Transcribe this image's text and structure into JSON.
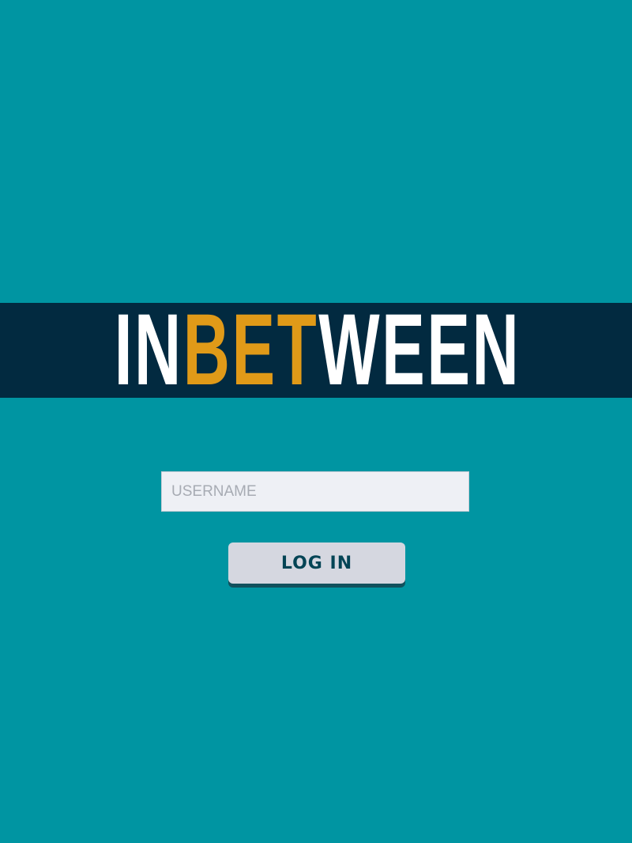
{
  "logo": {
    "part_in": "IN",
    "part_bet": "BET",
    "part_ween": "WEEN"
  },
  "login_form": {
    "username_placeholder": "USERNAME",
    "username_value": "",
    "login_label": "LOG IN"
  },
  "colors": {
    "background": "#0095a2",
    "logo_band": "#022a40",
    "logo_accent": "#e09a18",
    "logo_text": "#ffffff",
    "button_face": "#d5d7e0",
    "button_text": "#034455"
  }
}
